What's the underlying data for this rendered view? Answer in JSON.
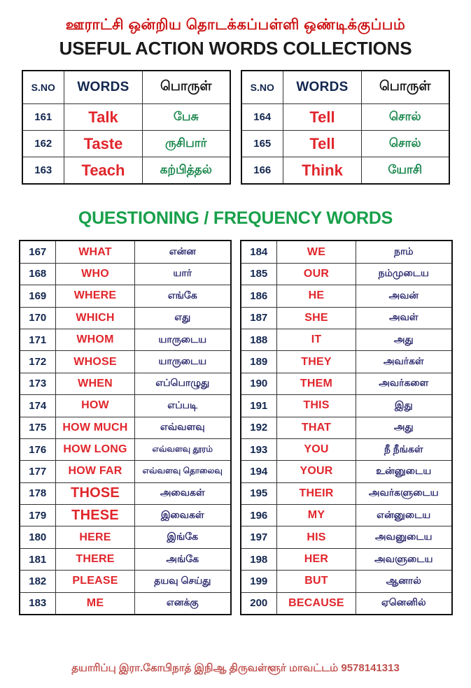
{
  "header": {
    "tamil_title": "ஊராட்சி ஒன்றிய தொடக்கப்பள்ளி ஒண்டிக்குப்பம்",
    "main_title": "USEFUL ACTION WORDS COLLECTIONS"
  },
  "section": {
    "title": "QUESTIONING / FREQUENCY WORDS"
  },
  "colors": {
    "tamil_title_red": "#cc1111",
    "word_red": "#e0262c",
    "header_navy": "#12264f",
    "meaning_green": "#16854a",
    "meaning_navy": "#2b2a6e",
    "section_green": "#18a04a",
    "footer_red": "#c0504d",
    "border_black": "#111111"
  },
  "top_tables": {
    "headers": {
      "sno": "S.NO",
      "words": "WORDS",
      "meaning": "பொருள்"
    },
    "left_rows": [
      {
        "sno": "161",
        "word": "Talk",
        "meaning": "பேசு"
      },
      {
        "sno": "162",
        "word": "Taste",
        "meaning": "ருசிபார்"
      },
      {
        "sno": "163",
        "word": "Teach",
        "meaning": "கற்பித்தல்"
      }
    ],
    "right_rows": [
      {
        "sno": "164",
        "word": "Tell",
        "meaning": "சொல்"
      },
      {
        "sno": "165",
        "word": "Tell",
        "meaning": "சொல்"
      },
      {
        "sno": "166",
        "word": "Think",
        "meaning": "யோசி"
      }
    ]
  },
  "main_tables": {
    "left_rows": [
      {
        "sno": "167",
        "word": "WHAT",
        "meaning": "என்ன"
      },
      {
        "sno": "168",
        "word": "WHO",
        "meaning": "யார்"
      },
      {
        "sno": "169",
        "word": "WHERE",
        "meaning": "எங்கே"
      },
      {
        "sno": "170",
        "word": "WHICH",
        "meaning": "எது"
      },
      {
        "sno": "171",
        "word": "WHOM",
        "meaning": "யாருடைய"
      },
      {
        "sno": "172",
        "word": "WHOSE",
        "meaning": "யாருடைய"
      },
      {
        "sno": "173",
        "word": "WHEN",
        "meaning": "எப்பொழுது"
      },
      {
        "sno": "174",
        "word": "HOW",
        "meaning": "எப்படி"
      },
      {
        "sno": "175",
        "word": "HOW MUCH",
        "meaning": "எவ்வளவு"
      },
      {
        "sno": "176",
        "word": "HOW LONG",
        "meaning": "எவ்வளவு தூரம்"
      },
      {
        "sno": "177",
        "word": "HOW FAR",
        "meaning": "எவ்வளவு தொலைவு"
      },
      {
        "sno": "178",
        "word": "THOSE",
        "meaning": "அவைகள்"
      },
      {
        "sno": "179",
        "word": "THESE",
        "meaning": "இவைகள்"
      },
      {
        "sno": "180",
        "word": "HERE",
        "meaning": "இங்கே"
      },
      {
        "sno": "181",
        "word": "THERE",
        "meaning": "அங்கே"
      },
      {
        "sno": "182",
        "word": "PLEASE",
        "meaning": "தயவு செய்து"
      },
      {
        "sno": "183",
        "word": "ME",
        "meaning": "எனக்கு"
      }
    ],
    "right_rows": [
      {
        "sno": "184",
        "word": "WE",
        "meaning": "நாம்"
      },
      {
        "sno": "185",
        "word": "OUR",
        "meaning": "நம்முடைய"
      },
      {
        "sno": "186",
        "word": "HE",
        "meaning": "அவன்"
      },
      {
        "sno": "187",
        "word": "SHE",
        "meaning": "அவள்"
      },
      {
        "sno": "188",
        "word": "IT",
        "meaning": "அது"
      },
      {
        "sno": "189",
        "word": "THEY",
        "meaning": "அவர்கள்"
      },
      {
        "sno": "190",
        "word": "THEM",
        "meaning": "அவர்களை"
      },
      {
        "sno": "191",
        "word": "THIS",
        "meaning": "இது"
      },
      {
        "sno": "192",
        "word": "THAT",
        "meaning": "அது"
      },
      {
        "sno": "193",
        "word": "YOU",
        "meaning": "நீ நீங்கள்"
      },
      {
        "sno": "194",
        "word": "YOUR",
        "meaning": "உன்னுடைய"
      },
      {
        "sno": "195",
        "word": "THEIR",
        "meaning": "அவர்களுடைய"
      },
      {
        "sno": "196",
        "word": "MY",
        "meaning": "என்னுடைய"
      },
      {
        "sno": "197",
        "word": "HIS",
        "meaning": "அவனுடைய"
      },
      {
        "sno": "198",
        "word": "HER",
        "meaning": "அவளுடைய"
      },
      {
        "sno": "199",
        "word": "BUT",
        "meaning": "ஆனால்"
      },
      {
        "sno": "200",
        "word": "BECAUSE",
        "meaning": "ஏனெனில்"
      }
    ]
  },
  "footer": {
    "text": "தயாரிப்பு இரா.கோபிநாத் இநிஆ திருவள்ளூர் மாவட்டம் 9578141313"
  }
}
